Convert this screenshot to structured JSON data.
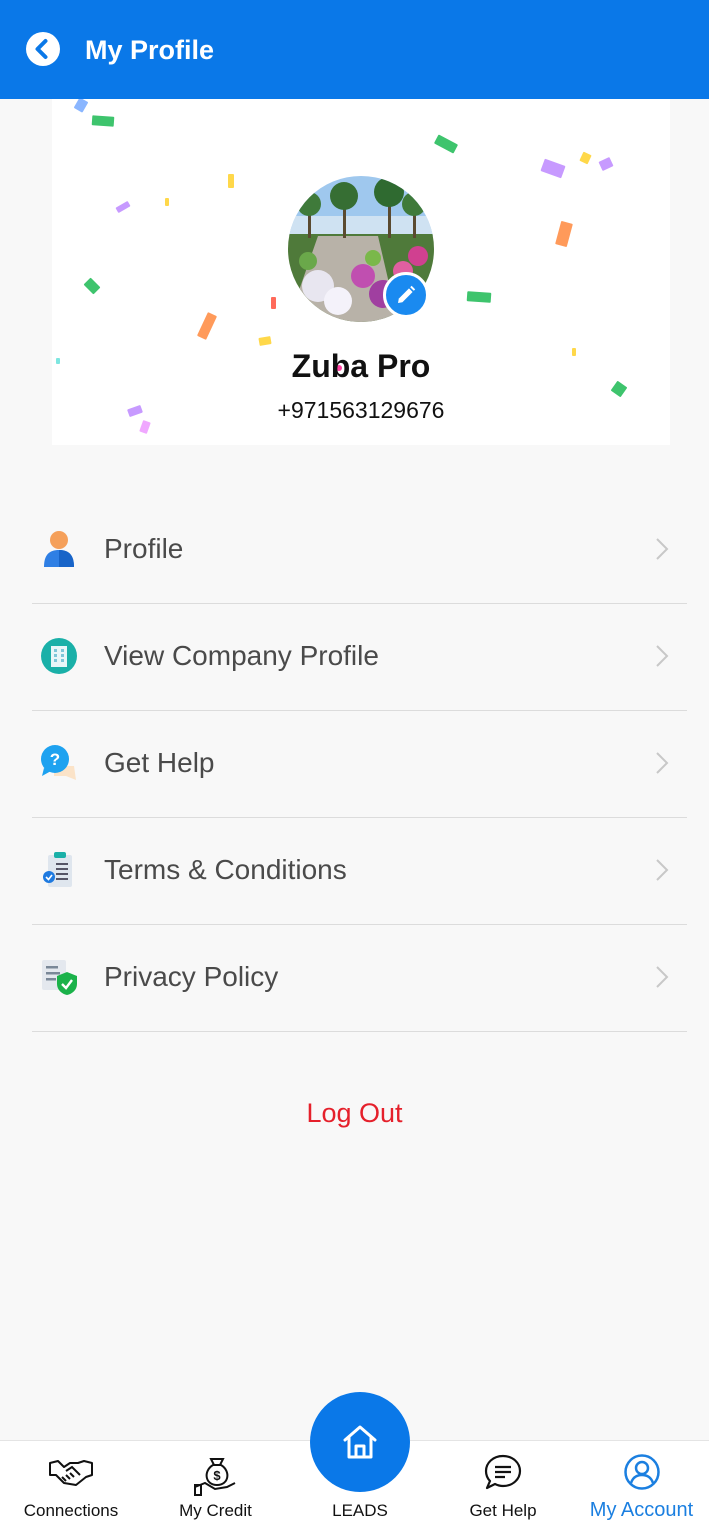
{
  "header": {
    "title": "My Profile",
    "back_icon": "chevron-left-icon",
    "background": "#0a78e8"
  },
  "profile": {
    "name": "Zuba Pro",
    "phone": "+971563129676",
    "edit_icon": "pencil-icon"
  },
  "menu": {
    "items": [
      {
        "label": "Profile",
        "icon": "user-icon"
      },
      {
        "label": "View Company Profile",
        "icon": "building-icon"
      },
      {
        "label": "Get Help",
        "icon": "help-chat-icon"
      },
      {
        "label": "Terms & Conditions",
        "icon": "clipboard-icon"
      },
      {
        "label": "Privacy Policy",
        "icon": "shield-check-icon"
      }
    ]
  },
  "logout_label": "Log Out",
  "bottom_nav": {
    "items": [
      {
        "label": "Connections",
        "icon": "handshake-icon"
      },
      {
        "label": "My Credit",
        "icon": "money-bag-icon"
      },
      {
        "label": "LEADS",
        "icon": "home-icon"
      },
      {
        "label": "Get Help",
        "icon": "chat-bubble-icon"
      },
      {
        "label": "My Account",
        "icon": "account-circle-icon"
      }
    ],
    "active_label": "My Account",
    "active_color": "#1b7fe0"
  },
  "colors": {
    "accent": "#0a78e8",
    "logout": "#e5202b"
  }
}
